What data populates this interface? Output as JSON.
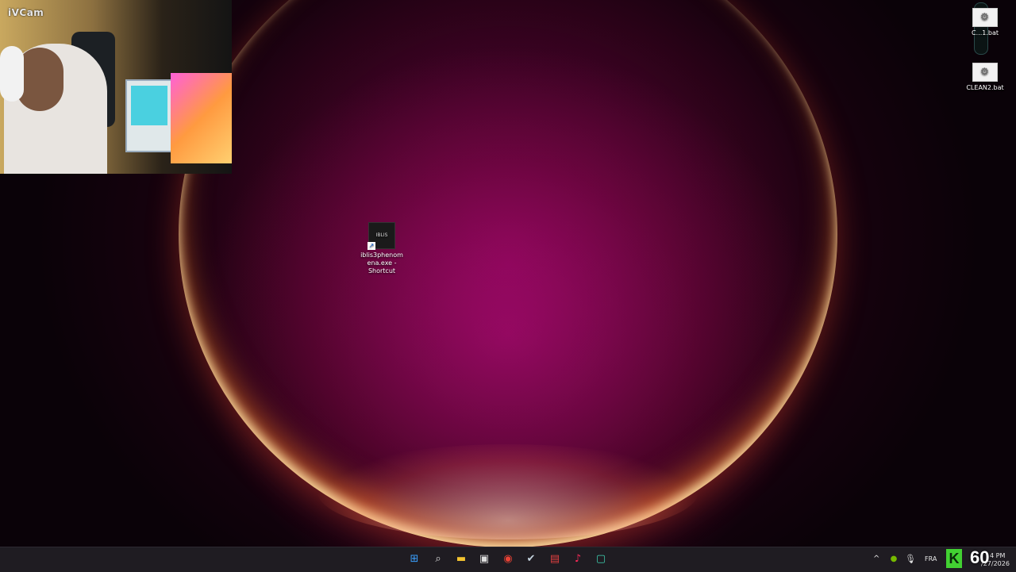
{
  "webcam": {
    "label": "iVCam"
  },
  "desktop": {
    "icons": [
      {
        "label": "C...1.bat",
        "icon": "batch-file-icon"
      },
      {
        "label": "CLEAN2.bat",
        "icon": "batch-file-icon"
      },
      {
        "label": "iblis3phenomena.exe - Shortcut",
        "line1": "iblis3phenom",
        "line2": "ena.exe -",
        "line3": "Shortcut",
        "icon": "game-shortcut-icon",
        "thumb_text": "IBLIS"
      }
    ]
  },
  "taskbar": {
    "apps": [
      {
        "name": "start-icon",
        "glyph": "⊞",
        "color": "#3aa0ff"
      },
      {
        "name": "search-icon",
        "glyph": "⌕",
        "color": "#e6e6e6"
      },
      {
        "name": "file-explorer-icon",
        "glyph": "▬",
        "color": "#f4c430"
      },
      {
        "name": "store-icon",
        "glyph": "▣",
        "color": "#d8d8d8"
      },
      {
        "name": "chrome-icon",
        "glyph": "◉",
        "color": "#e94235"
      },
      {
        "name": "steam-icon",
        "glyph": "✔",
        "color": "#c6d4df"
      },
      {
        "name": "voicemeeter-icon",
        "glyph": "▤",
        "color": "#e04040"
      },
      {
        "name": "tiktok-icon",
        "glyph": "♪",
        "color": "#ff2a5a"
      },
      {
        "name": "app-icon",
        "glyph": "▢",
        "color": "#3fd0b0"
      }
    ],
    "tray": {
      "chevron": "^",
      "language": "FRA",
      "time": "4 PM",
      "date": "/27/2026"
    },
    "overlay": {
      "k_letter": "K",
      "fps": "60"
    }
  }
}
